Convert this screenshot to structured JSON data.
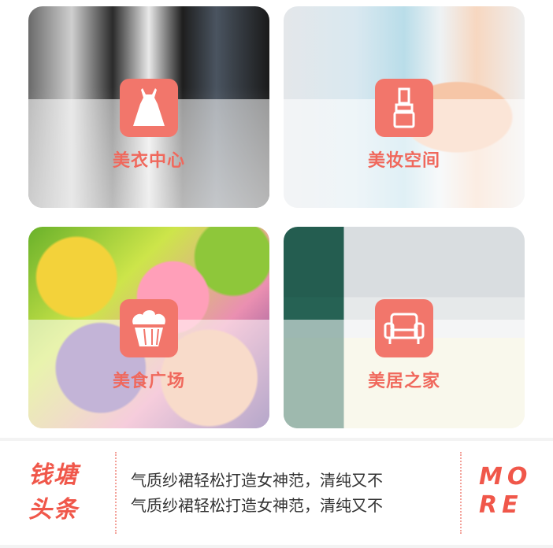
{
  "categories": [
    {
      "label": "美衣中心",
      "icon": "dress-icon"
    },
    {
      "label": "美妆空间",
      "icon": "lipstick-icon"
    },
    {
      "label": "美食广场",
      "icon": "cupcake-icon"
    },
    {
      "label": "美居之家",
      "icon": "armchair-icon"
    }
  ],
  "news": {
    "title_line1": "钱塘",
    "title_line2": "头条",
    "items": [
      "气质纱裙轻松打造女神范，清纯又不",
      "气质纱裙轻松打造女神范，清纯又不"
    ],
    "more_line1": "MO",
    "more_line2": "RE"
  },
  "colors": {
    "accent": "#f2766b",
    "title": "#f0574a"
  }
}
